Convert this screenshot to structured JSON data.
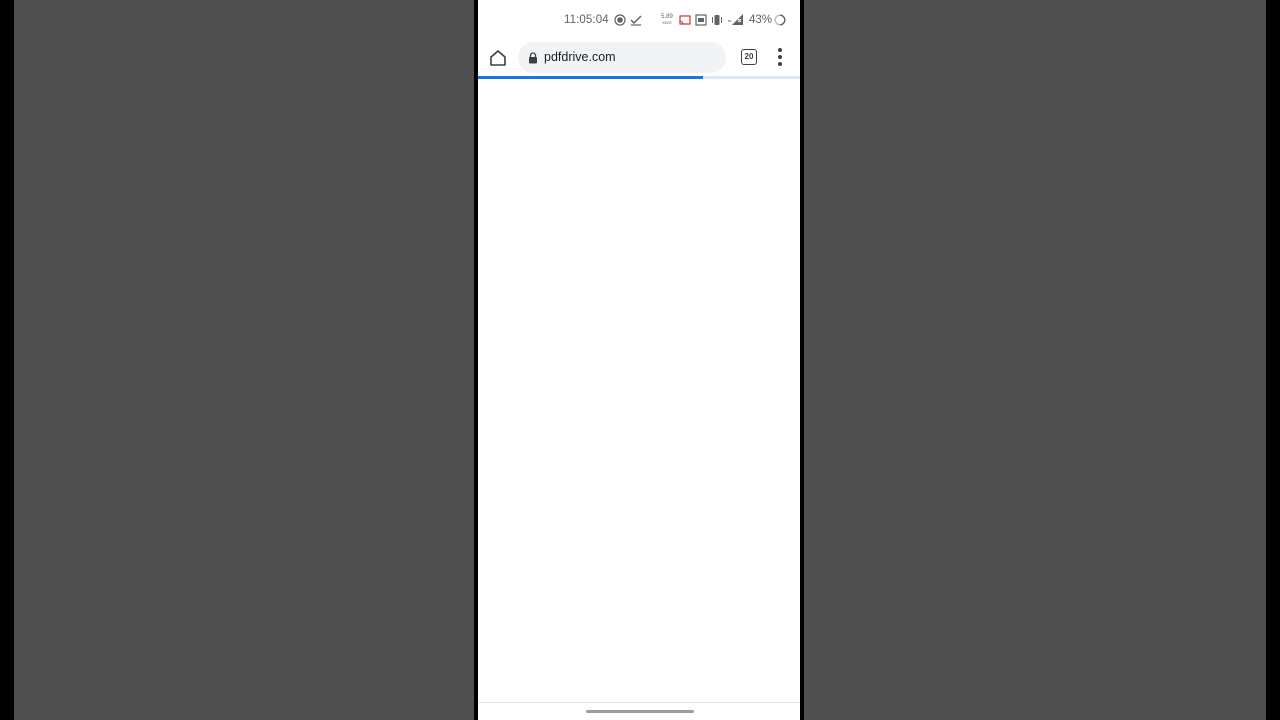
{
  "status_bar": {
    "time": "11:05:04",
    "net_speed_top": "5.89",
    "net_speed_bottom": "KB/S",
    "battery_percent": "43%"
  },
  "toolbar": {
    "url": "pdfdrive.com",
    "tab_count": "20"
  },
  "page_load_progress": 0.7,
  "colors": {
    "progress": "#1a73e8",
    "url_bar_bg": "#f1f3f4",
    "backdrop": "#4f4f4f"
  },
  "icons": {
    "home": "home-icon",
    "lock": "lock-icon",
    "menu": "more-vert-icon"
  }
}
